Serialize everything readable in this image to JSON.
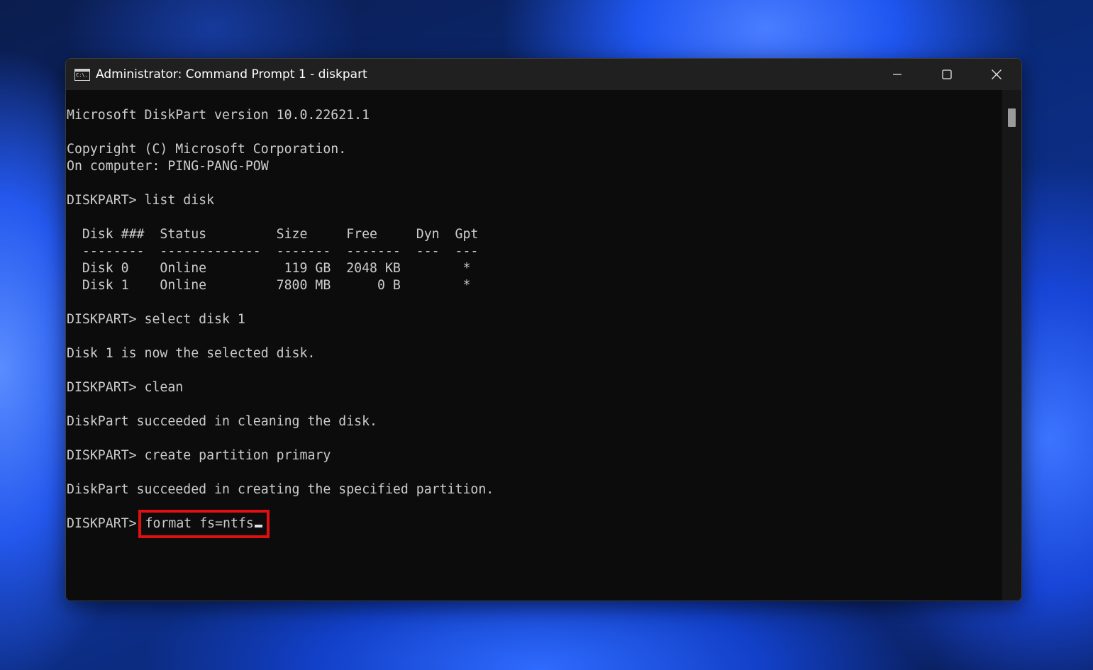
{
  "window": {
    "title": "Administrator: Command Prompt 1 - diskpart",
    "icon_glyph": "C:\\.",
    "icons": {
      "app": "command-prompt-icon",
      "minimize": "minimize-icon",
      "maximize": "maximize-icon",
      "close": "close-icon"
    }
  },
  "console": {
    "lines": [
      "Microsoft DiskPart version 10.0.22621.1",
      "",
      "Copyright (C) Microsoft Corporation.",
      "On computer: PING-PANG-POW",
      "",
      "DISKPART> list disk",
      "",
      "  Disk ###  Status         Size     Free     Dyn  Gpt",
      "  --------  -------------  -------  -------  ---  ---",
      "  Disk 0    Online          119 GB  2048 KB        *",
      "  Disk 1    Online         7800 MB      0 B        *",
      "",
      "DISKPART> select disk 1",
      "",
      "Disk 1 is now the selected disk.",
      "",
      "DISKPART> clean",
      "",
      "DiskPart succeeded in cleaning the disk.",
      "",
      "DISKPART> create partition primary",
      "",
      "DiskPart succeeded in creating the specified partition.",
      ""
    ],
    "current_prompt": "DISKPART>",
    "current_command": "format fs=ntfs"
  },
  "colors": {
    "console_bg": "#0c0c0c",
    "console_text": "#cccccc",
    "titlebar_bg": "#202020",
    "highlight": "#e10f0f"
  }
}
